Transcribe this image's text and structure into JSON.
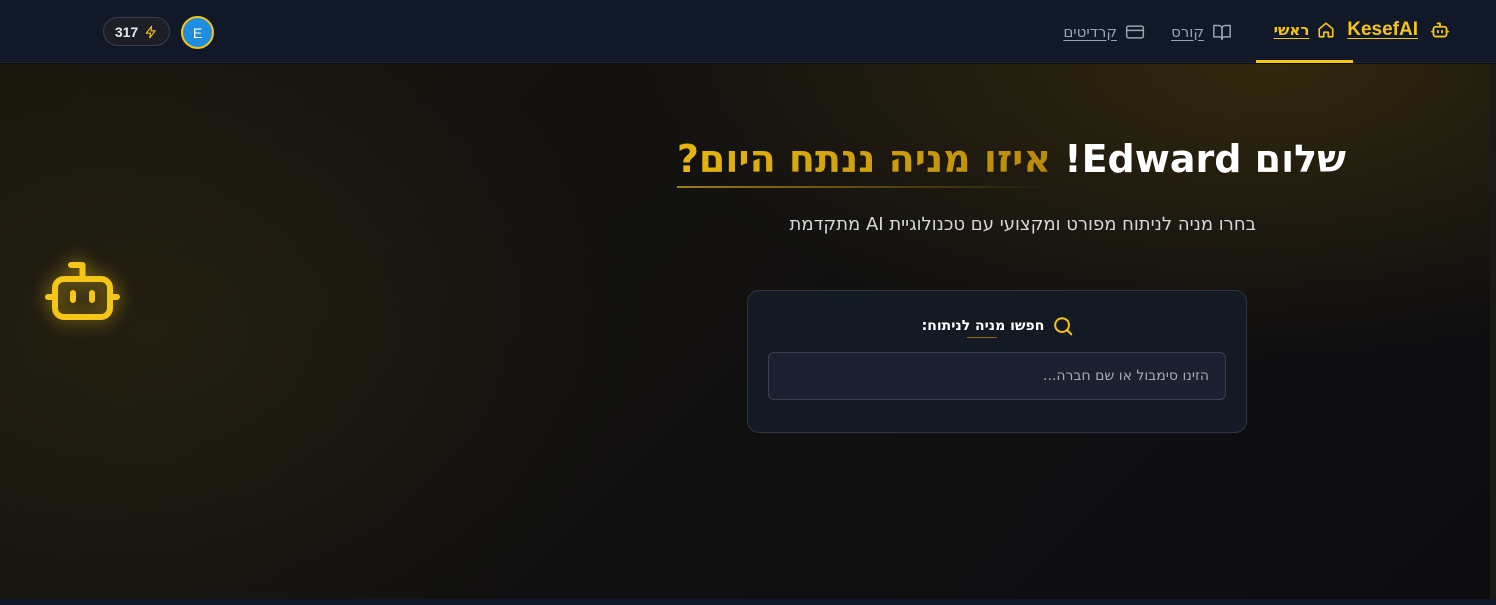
{
  "nav": {
    "brand": "KesefAI",
    "home_label": "ראשי",
    "course_label": "קורס",
    "credits_label": "קרדיטים",
    "credit_count": "317",
    "avatar_initial": "E"
  },
  "hero": {
    "greeting": "שלום Edward!",
    "question": "איזו מניה ננתח היום?",
    "subtitle": "בחרו מניה לניתוח מפורט ומקצועי עם טכנולוגיית AI מתקדמת"
  },
  "search": {
    "label": "חפשו מניה לניתוח:",
    "placeholder": "הזינו סימבול או שם חברה..."
  },
  "colors": {
    "accent": "#f5c518",
    "nav_bg": "#111827",
    "card_bg": "#141a24"
  },
  "icons": {
    "brand": "robot-icon",
    "home": "home-icon",
    "course": "book-open-icon",
    "credits": "credit-card-icon",
    "bolt": "lightning-icon",
    "search": "search-icon",
    "hero": "robot-icon"
  }
}
